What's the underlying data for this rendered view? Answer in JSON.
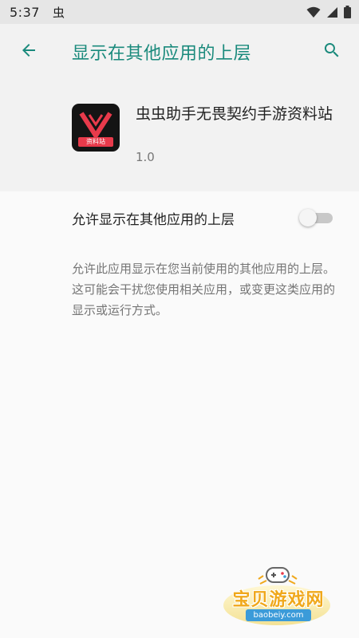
{
  "status_bar": {
    "time": "5:37",
    "notification_glyph": "虫",
    "icons": [
      "wifi-icon",
      "signal-icon",
      "battery-icon"
    ]
  },
  "app_bar": {
    "title": "显示在其他应用的上层",
    "back_icon": "arrow-back-icon",
    "search_icon": "search-icon",
    "accent_color": "#1a8a7c"
  },
  "app_info": {
    "name": "虫虫助手无畏契约手游资料站",
    "version": "1.0",
    "icon_tag": "资料站",
    "icon_color": "#e83a4b"
  },
  "setting": {
    "label": "允许显示在其他应用的上层",
    "enabled": false
  },
  "description": "允许此应用显示在您当前使用的其他应用的上层。这可能会干扰您使用相关应用，或变更这类应用的显示或运行方式。",
  "watermark": {
    "text": "宝贝游戏网",
    "url": "baobeiy.com"
  }
}
